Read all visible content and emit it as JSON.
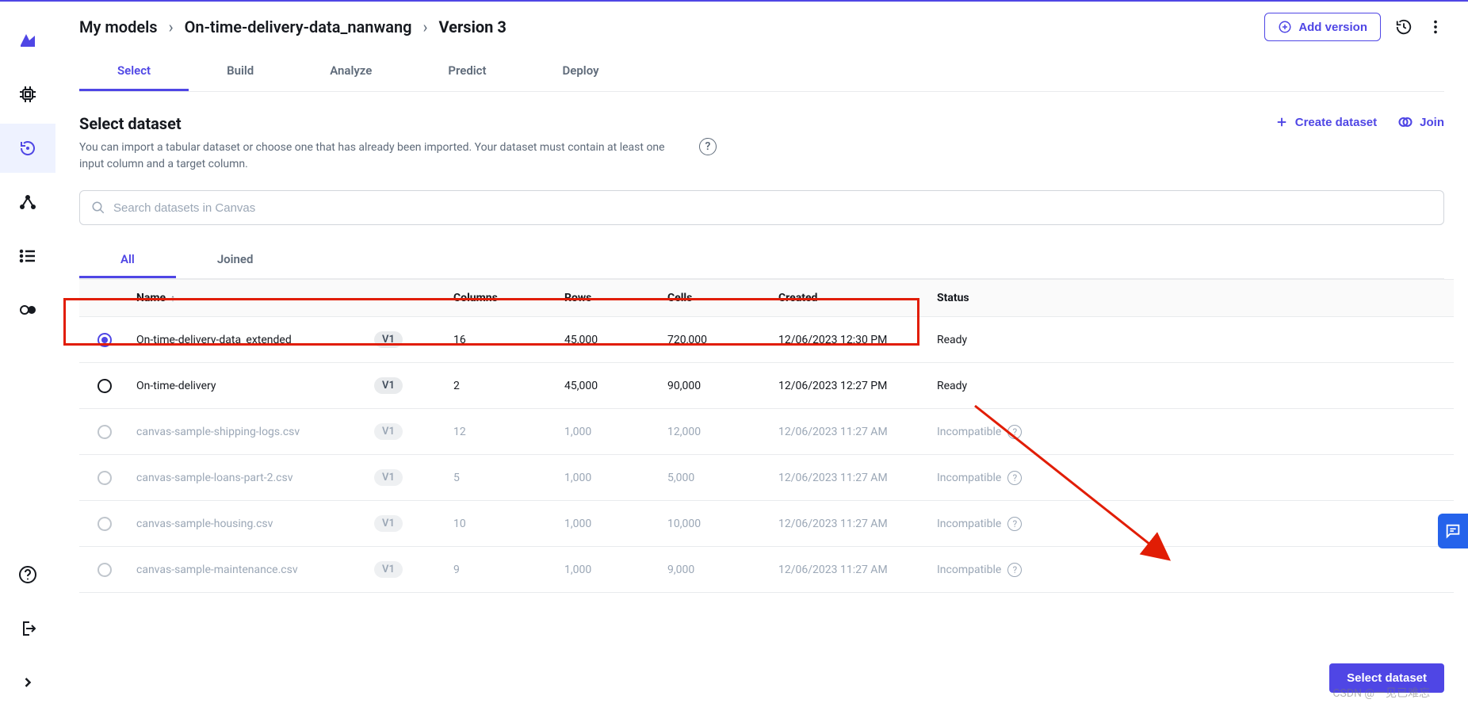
{
  "breadcrumb": {
    "root": "My models",
    "project": "On-time-delivery-data_nanwang",
    "version": "Version 3"
  },
  "actions": {
    "add_version": "Add version"
  },
  "top_tabs": [
    "Select",
    "Build",
    "Analyze",
    "Predict",
    "Deploy"
  ],
  "section": {
    "title": "Select dataset",
    "description": "You can import a tabular dataset or choose one that has already been imported. Your dataset must contain at least one input column and a target column.",
    "create": "Create dataset",
    "join": "Join"
  },
  "search": {
    "placeholder": "Search datasets in Canvas"
  },
  "sub_tabs": [
    "All",
    "Joined"
  ],
  "columns": {
    "name": "Name",
    "columns": "Columns",
    "rows": "Rows",
    "cells": "Cells",
    "created": "Created",
    "status": "Status"
  },
  "datasets": [
    {
      "name": "On-time-delivery-data_extended",
      "ver": "V1",
      "cols": "16",
      "rows": "45,000",
      "cells": "720,000",
      "created": "12/06/2023 12:30 PM",
      "status": "Ready",
      "selected": true,
      "enabled": true
    },
    {
      "name": "On-time-delivery",
      "ver": "V1",
      "cols": "2",
      "rows": "45,000",
      "cells": "90,000",
      "created": "12/06/2023 12:27 PM",
      "status": "Ready",
      "selected": false,
      "enabled": true
    },
    {
      "name": "canvas-sample-shipping-logs.csv",
      "ver": "V1",
      "cols": "12",
      "rows": "1,000",
      "cells": "12,000",
      "created": "12/06/2023 11:27 AM",
      "status": "Incompatible",
      "selected": false,
      "enabled": false
    },
    {
      "name": "canvas-sample-loans-part-2.csv",
      "ver": "V1",
      "cols": "5",
      "rows": "1,000",
      "cells": "5,000",
      "created": "12/06/2023 11:27 AM",
      "status": "Incompatible",
      "selected": false,
      "enabled": false
    },
    {
      "name": "canvas-sample-housing.csv",
      "ver": "V1",
      "cols": "10",
      "rows": "1,000",
      "cells": "10,000",
      "created": "12/06/2023 11:27 AM",
      "status": "Incompatible",
      "selected": false,
      "enabled": false
    },
    {
      "name": "canvas-sample-maintenance.csv",
      "ver": "V1",
      "cols": "9",
      "rows": "1,000",
      "cells": "9,000",
      "created": "12/06/2023 11:27 AM",
      "status": "Incompatible",
      "selected": false,
      "enabled": false
    }
  ],
  "footer": {
    "select_dataset": "Select dataset"
  },
  "watermark": "CSDN @一见已难忘"
}
